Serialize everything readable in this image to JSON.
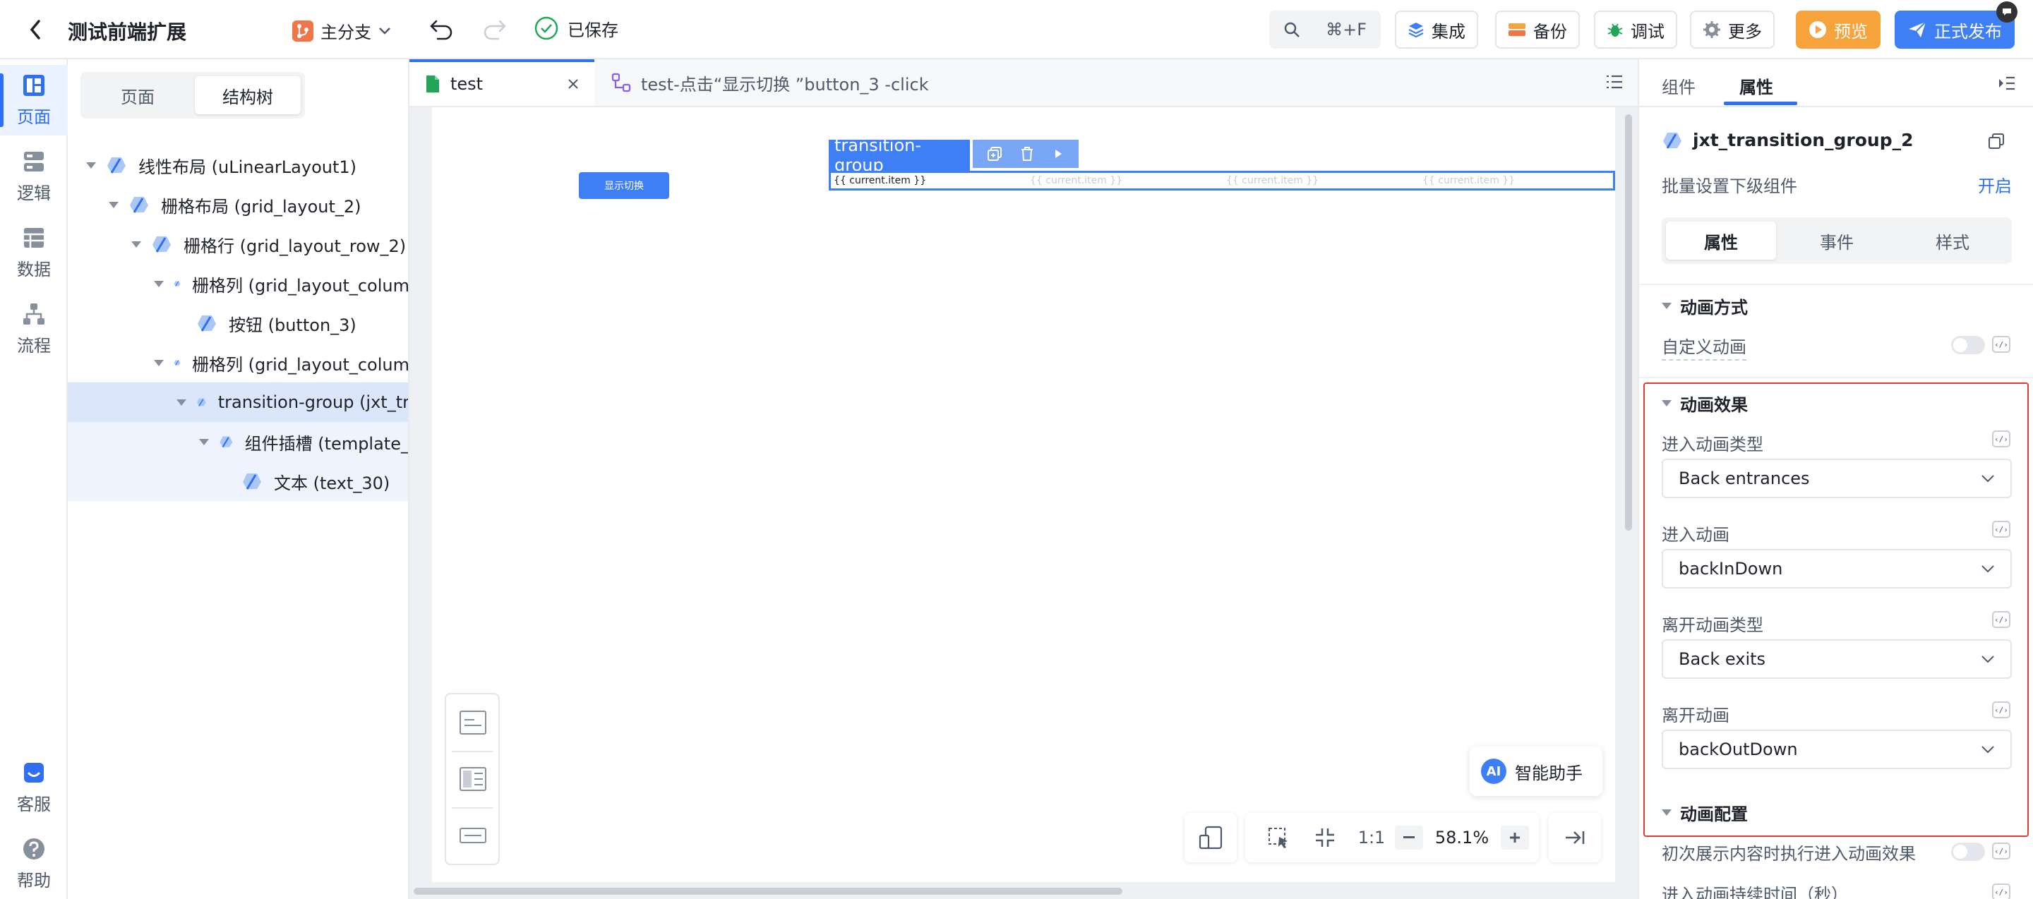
{
  "header": {
    "back_label": "",
    "app_title": "测试前端扩展",
    "branch": "主分支",
    "save_status": "已保存",
    "search_shortcut": "⌘+F",
    "buttons": {
      "integrate": "集成",
      "backup": "备份",
      "debug": "调试",
      "more": "更多",
      "preview": "预览",
      "publish": "正式发布"
    }
  },
  "leftnav": {
    "items": [
      {
        "label": "页面",
        "icon": "page-icon"
      },
      {
        "label": "逻辑",
        "icon": "logic-icon"
      },
      {
        "label": "数据",
        "icon": "data-icon"
      },
      {
        "label": "流程",
        "icon": "flow-icon"
      }
    ],
    "bottom": [
      {
        "label": "客服",
        "icon": "support-icon"
      },
      {
        "label": "帮助",
        "icon": "help-icon"
      }
    ]
  },
  "tree": {
    "tabs": [
      "页面",
      "结构树"
    ],
    "active_tab": "结构树",
    "nodes": [
      {
        "label": "线性布局 (uLinearLayout1)"
      },
      {
        "label": "栅格布局 (grid_layout_2)"
      },
      {
        "label": "栅格行 (grid_layout_row_2)"
      },
      {
        "label": "栅格列 (grid_layout_colum"
      },
      {
        "label": "按钮 (button_3)"
      },
      {
        "label": "栅格列 (grid_layout_colum"
      },
      {
        "label": "transition-group (jxt_tr"
      },
      {
        "label": "组件插槽 (template_"
      },
      {
        "label": "文本 (text_30)"
      }
    ]
  },
  "editor_tabs": [
    {
      "label": "test"
    },
    {
      "label": "test-点击“显示切换 ”button_3 -click"
    }
  ],
  "canvas": {
    "button_label": "显示切换",
    "group_label": "transition-group",
    "items": [
      "{{ current.item }}",
      "{{ current.item }}",
      "{{ current.item }}",
      "{{ current.item }}"
    ],
    "ai_badge": "AI",
    "ai_label": "智能助手",
    "zoom_ratio": "1:1",
    "zoom_value": "58.1%"
  },
  "panel": {
    "tabs": [
      "组件",
      "属性"
    ],
    "active_tab": "属性",
    "component_name": "jxt_transition_group_2",
    "batch_label": "批量设置下级组件",
    "batch_action": "开启",
    "sub_tabs": [
      "属性",
      "事件",
      "样式"
    ],
    "sections": {
      "anim_mode": {
        "title": "动画方式",
        "custom_label": "自定义动画"
      },
      "anim_effect": {
        "title": "动画效果",
        "fields": [
          {
            "label": "进入动画类型",
            "value": "Back entrances"
          },
          {
            "label": "进入动画",
            "value": "backInDown"
          },
          {
            "label": "离开动画类型",
            "value": "Back exits"
          },
          {
            "label": "离开动画",
            "value": "backOutDown"
          }
        ]
      },
      "anim_config": {
        "title": "动画配置",
        "initial_label": "初次展示内容时执行进入动画效果",
        "duration_label": "进入动画持续时间（秒）"
      }
    },
    "code_glyph": "‹/›"
  },
  "colors": {
    "primary": "#3f7ff5",
    "highlight_border": "#e53935",
    "preview_orange": "#f7a33b"
  }
}
